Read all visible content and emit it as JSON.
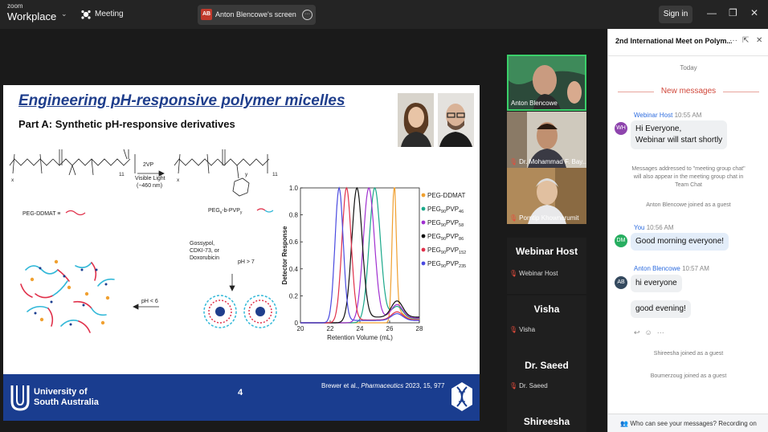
{
  "topbar": {
    "brand_small": "zoom",
    "brand_main": "Workplace",
    "meeting_label": "Meeting",
    "screen_badge": "AB",
    "screen_title": "Anton Blencowe's screen",
    "signin_label": "Sign in"
  },
  "slide": {
    "title": "Engineering pH-responsive polymer micelles",
    "subtitle": "Part A: Synthetic pH-responsive derivatives",
    "chem": {
      "reagent_2vp": "2VP",
      "visible_light": "Visible Light",
      "wavelength": "(~460 nm)",
      "peg_ddmat": "PEG-DDMAT ≡",
      "subscript_11": "11",
      "subscript_x": "x",
      "subscript_y": "y",
      "product_label": "PEG",
      "product_b": "-b-PVP",
      "drugs_1": "Gossypol,",
      "drugs_2": "CDKI-73, or",
      "drugs_3": "Doxorubicin",
      "ph_high": "pH > 7",
      "ph_low": "pH < 6"
    },
    "footer": {
      "uni_line1": "University of",
      "uni_line2": "South Australia",
      "page_number": "4",
      "citation_authors": "Brewer et al., ",
      "citation_journal": "Pharmaceutics",
      "citation_rest": " 2023, 15, 977"
    }
  },
  "chart_data": {
    "type": "line",
    "title": "",
    "xlabel": "Retention Volume (mL)",
    "ylabel": "Detector Response",
    "xlim": [
      20,
      28
    ],
    "ylim": [
      0,
      1.0
    ],
    "xticks": [
      "20",
      "22",
      "24",
      "26",
      "28"
    ],
    "yticks": [
      "0",
      "0.2",
      "0.4",
      "0.6",
      "0.8",
      "1.0"
    ],
    "legend_position": "right",
    "series": [
      {
        "name": "PEG-DDMAT",
        "name_sub": "",
        "color": "#f0a030",
        "peak": 26.3,
        "width": 0.28,
        "tail": 0.07
      },
      {
        "name": "PEG",
        "name_sub": "90",
        "name_tail": "PVP",
        "name_tail_sub": "46",
        "color": "#1aa88a",
        "peak": 25.0,
        "width": 0.75,
        "tail": 0.09
      },
      {
        "name": "PEG",
        "name_sub": "90",
        "name_tail": "PVP",
        "name_tail_sub": "58",
        "color": "#a030d0",
        "peak": 24.6,
        "width": 0.75,
        "tail": 0.1
      },
      {
        "name": "PEG",
        "name_sub": "90",
        "name_tail": "PVP",
        "name_tail_sub": "86",
        "color": "#111111",
        "peak": 23.8,
        "width": 0.7,
        "tail": 0.12
      },
      {
        "name": "PEG",
        "name_sub": "90",
        "name_tail": "PVP",
        "name_tail_sub": "152",
        "color": "#e0304a",
        "peak": 23.1,
        "width": 0.62,
        "tail": 0.06
      },
      {
        "name": "PEG",
        "name_sub": "90",
        "name_tail": "PVP",
        "name_tail_sub": "235",
        "color": "#4a4ae0",
        "peak": 22.6,
        "width": 0.55,
        "tail": 0.05
      }
    ]
  },
  "videos": {
    "tiles": [
      {
        "name": "Anton Blencowe",
        "muted": false
      },
      {
        "name": "Dr. Mohammad F. Bay...",
        "muted": true
      },
      {
        "name": "Porntip Khownarumit",
        "muted": true
      }
    ],
    "name_tiles": [
      {
        "big": "Webinar Host",
        "small": "Webinar Host"
      },
      {
        "big": "Visha",
        "small": "Visha"
      },
      {
        "big": "Dr. Saeed",
        "small": "Dr. Saeed"
      },
      {
        "big": "Shireesha",
        "small": ""
      }
    ]
  },
  "chat": {
    "title": "2nd International Meet on Polym...",
    "today": "Today",
    "new_messages": "New messages",
    "messages": [
      {
        "avatar": "WH",
        "avatar_color": "#8e44ad",
        "sender": "Webinar Host",
        "time": "10:55 AM",
        "lines": [
          "Hi Everyone,",
          "Webinar will start shortly"
        ]
      },
      {
        "avatar": "DM",
        "avatar_color": "#27ae60",
        "sender": "You",
        "time": "10:56 AM",
        "lines": [
          "Good morning everyone!"
        ]
      },
      {
        "avatar": "AB",
        "avatar_color": "#34495e",
        "sender": "Anton Blencowe",
        "time": "10:57 AM",
        "lines": [
          "hi everyone"
        ],
        "extra": "good evening!"
      }
    ],
    "system": {
      "addressed_1": "Messages addressed to \"meeting group chat\"",
      "addressed_2": "will also appear in the meeting group chat in",
      "addressed_3": "Team Chat",
      "anton_joined": "Anton Blencowe joined as a guest",
      "shireesha_joined": "Shireesha joined as a guest",
      "boumerzoug_joined": "Boumerzoug joined as a guest"
    },
    "footer": "Who can see your messages? Recording on"
  }
}
